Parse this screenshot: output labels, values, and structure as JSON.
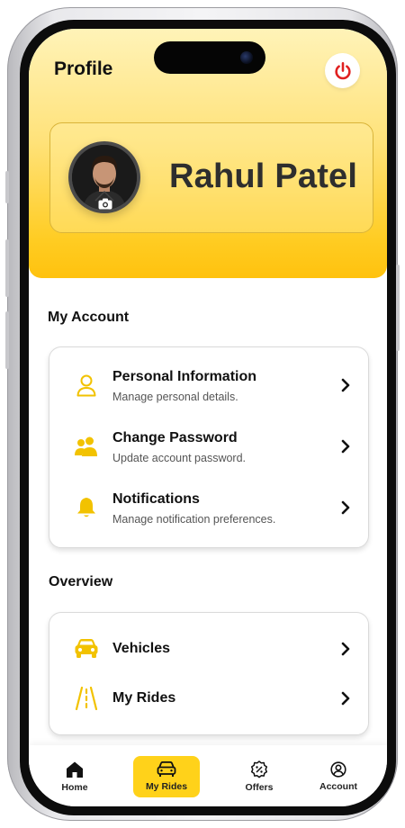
{
  "header": {
    "title": "Profile"
  },
  "profile": {
    "name": "Rahul Patel"
  },
  "my_account": {
    "title": "My Account",
    "items": [
      {
        "title": "Personal Information",
        "subtitle": "Manage personal details.",
        "icon": "user-icon"
      },
      {
        "title": "Change Password",
        "subtitle": "Update account password.",
        "icon": "users-icon"
      },
      {
        "title": "Notifications",
        "subtitle": "Manage notification preferences.",
        "icon": "bell-icon"
      }
    ]
  },
  "overview": {
    "title": "Overview",
    "items": [
      {
        "title": "Vehicles",
        "icon": "car-icon"
      },
      {
        "title": "My Rides",
        "icon": "road-icon"
      }
    ]
  },
  "bottom_nav": {
    "items": [
      {
        "label": "Home",
        "icon": "home-icon"
      },
      {
        "label": "My Rides",
        "icon": "car-icon",
        "active": true
      },
      {
        "label": "Offers",
        "icon": "discount-icon"
      },
      {
        "label": "Account",
        "icon": "account-icon"
      }
    ]
  },
  "colors": {
    "accent": "#ffc20e",
    "power": "#e02020",
    "icon_yellow": "#f2c200"
  }
}
